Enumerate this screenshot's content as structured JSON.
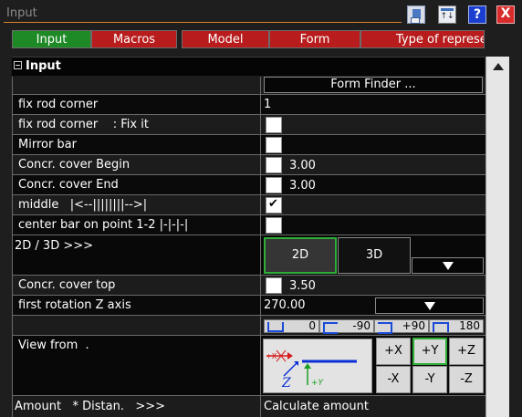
{
  "window": {
    "title_placeholder": "Input",
    "help_label": "?",
    "close_label": "X",
    "sort_label": "↑↓"
  },
  "tabs": [
    "Input",
    "Macros",
    "Model",
    "Form",
    "Type of represe"
  ],
  "section": {
    "title": "Input",
    "collapse_symbol": "−"
  },
  "rows": {
    "form_finder": {
      "button": "Form Finder ..."
    },
    "fix_rod_corner": {
      "label": "fix rod corner",
      "value": "1"
    },
    "fix_rod_corner_fix": {
      "label": "fix rod corner    : Fix it",
      "checked": false
    },
    "mirror_bar": {
      "label": "Mirror bar",
      "checked": false
    },
    "cover_begin": {
      "label": "Concr. cover Begin",
      "checked": false,
      "value": "3.00"
    },
    "cover_end": {
      "label": "Concr. cover End",
      "checked": false,
      "value": "3.00"
    },
    "middle": {
      "label": "middle   |<--||||||||-->|",
      "checked": true
    },
    "center_bar": {
      "label": "center bar on point 1-2 |-|-|-|",
      "checked": false
    },
    "dimension": {
      "label": "2D / 3D >>>",
      "btn_2d": "2D",
      "btn_3d": "3D",
      "selected": "2D"
    },
    "cover_top": {
      "label": "Concr. cover top",
      "checked": false,
      "value": "3.50"
    },
    "rotation": {
      "label": "first rotation Z axis",
      "value": "270.00"
    },
    "rotation_presets": [
      "0",
      "-90",
      "+90",
      "180"
    ],
    "view_from": {
      "label": "View from  .",
      "buttons": [
        "+X",
        "+Y",
        "+Z",
        "-X",
        "-Y",
        "-Z"
      ],
      "selected": "+Y",
      "preview_axes": [
        "+X",
        "Z",
        "+Y"
      ]
    },
    "amount": {
      "label": "Amount   * Distan.   >>>",
      "value": "Calculate amount"
    }
  },
  "colors": {
    "tab_active": "#1e8a25",
    "tab_inactive": "#b81c1c",
    "selection_border": "#2fae37",
    "title_underline": "#d9852a",
    "rotation_icon": "#1a4bd8"
  }
}
